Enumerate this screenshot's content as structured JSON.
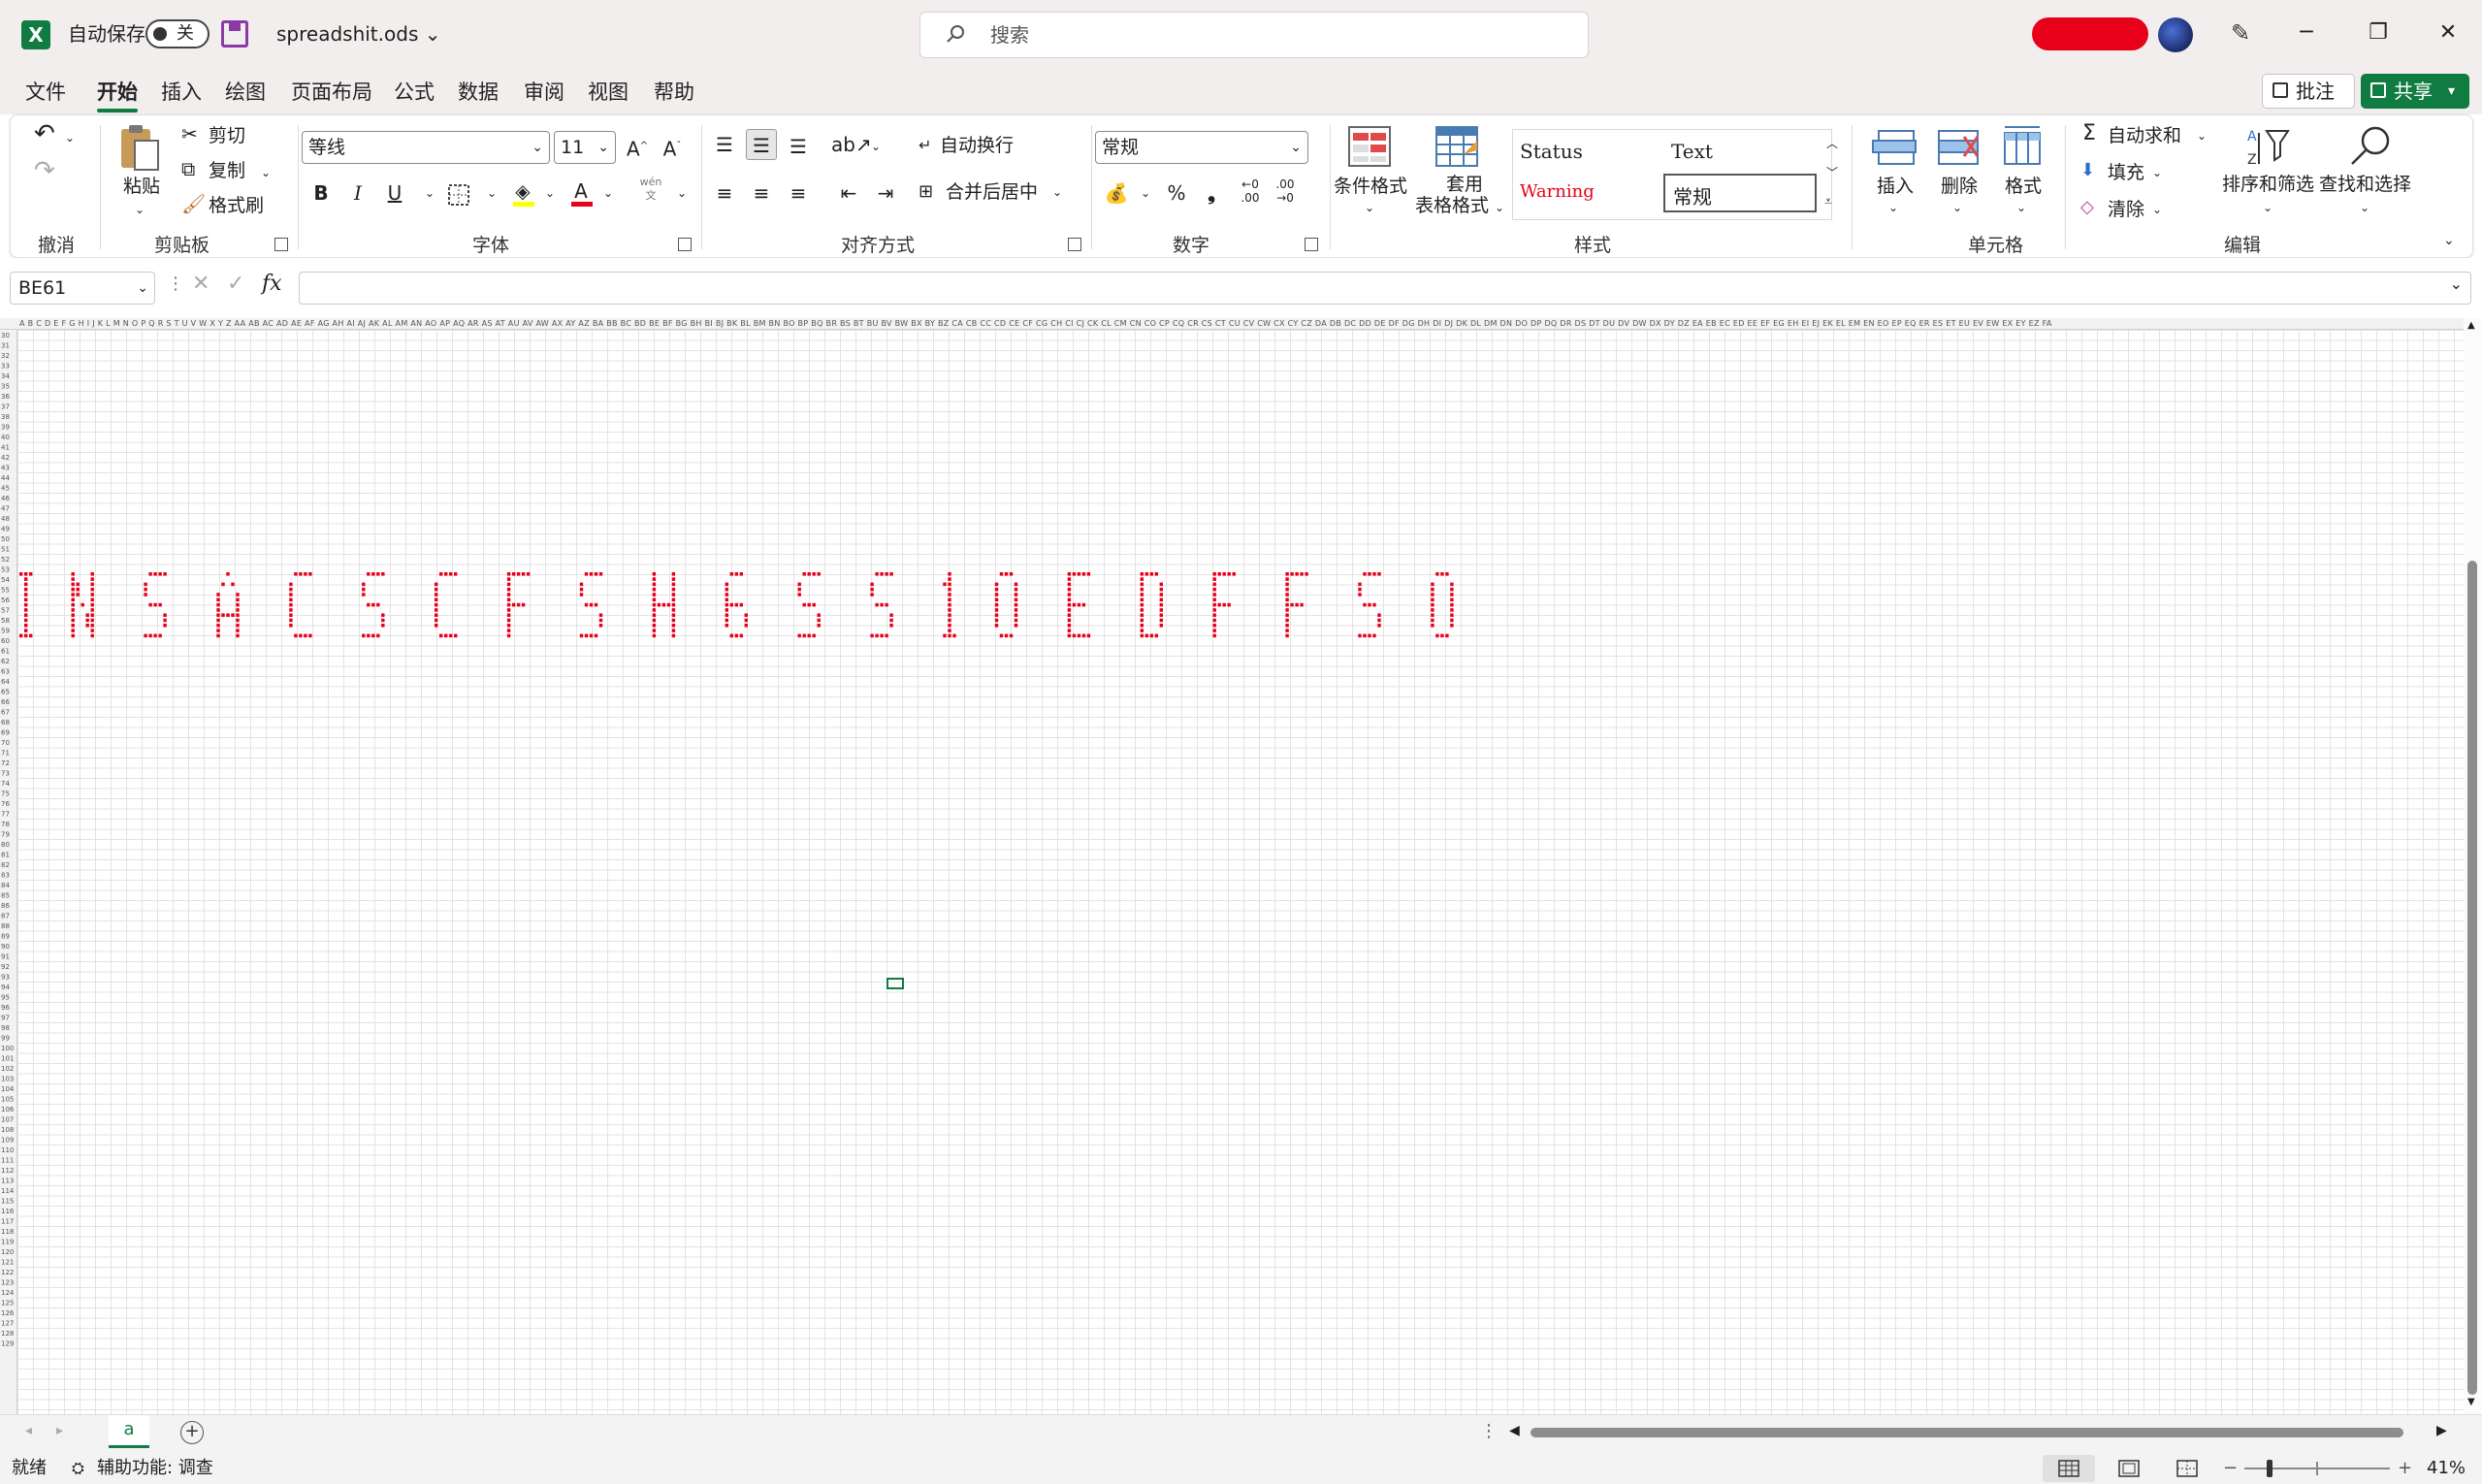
{
  "titlebar": {
    "autosave_label": "自动保存",
    "autosave_state": "关",
    "file_name": "spreadshit.ods ⌄",
    "search_placeholder": "搜索"
  },
  "menu": {
    "tabs": [
      "文件",
      "开始",
      "插入",
      "绘图",
      "页面布局",
      "公式",
      "数据",
      "审阅",
      "视图",
      "帮助"
    ],
    "active": "开始",
    "comment_label": "批注",
    "share_label": "共享"
  },
  "ribbon": {
    "undo_group": "撤消",
    "clipboard": {
      "paste": "粘贴",
      "cut": "剪切",
      "copy": "复制",
      "format_painter": "格式刷",
      "label": "剪贴板"
    },
    "font": {
      "name": "等线",
      "size": "11",
      "label": "字体"
    },
    "alignment": {
      "wrap": "自动换行",
      "merge": "合并后居中",
      "label": "对齐方式"
    },
    "number": {
      "format": "常规",
      "label": "数字"
    },
    "styles": {
      "conditional": "条件格式",
      "table_format_1": "套用",
      "table_format_2": "表格格式",
      "status": "Status",
      "text": "Text",
      "warning": "Warning",
      "normal": "常规",
      "label": "样式"
    },
    "cells": {
      "insert": "插入",
      "delete": "删除",
      "format": "格式",
      "label": "单元格"
    },
    "editing": {
      "autosum": "自动求和",
      "fill": "填充",
      "clear": "清除",
      "sort": "排序和筛选",
      "find": "查找和选择",
      "label": "编辑"
    }
  },
  "formula_bar": {
    "name_box": "BE61",
    "fx": "fx",
    "formula": ""
  },
  "grid": {
    "column_headers": "A B C D E F G H I J K L M N O P Q R S T U V W X Y Z AA AB AC AD AE AF AG AH AI AJ AK AL AM AN AO AP AQ AR AS AT AU AV AW AX AY AZ BA BB BC BD BE BF BG BH BI BJ BK BL BM BN BO BP BQ BR BS BT BU BV BW BX BY BZ CA CB CC CD CE CF CG CH CI CJ CK CL CM CN CO CP CQ CR CS CT CU CV CW CX CY CZ DA DB DC DD DE DF DG DH DI DJ DK DL DM DN DO DP DQ DR DS DT DU DV DW DX DY DZ EA EB EC ED EE EF EG EH EI EJ EK EL EM EN EO EP EQ ER ES ET EU EV EW EX EY EZ FA",
    "row_start": 30,
    "row_end": 129,
    "pixel_text": "INSACSCFSH6SS1OEDFFSO",
    "pixel_color": "#e8001a",
    "selected_cell": "BE61"
  },
  "sheets": {
    "tabs": [
      "a"
    ],
    "active": "a"
  },
  "status": {
    "ready": "就绪",
    "accessibility": "辅助功能: 调查",
    "zoom": "41%"
  }
}
